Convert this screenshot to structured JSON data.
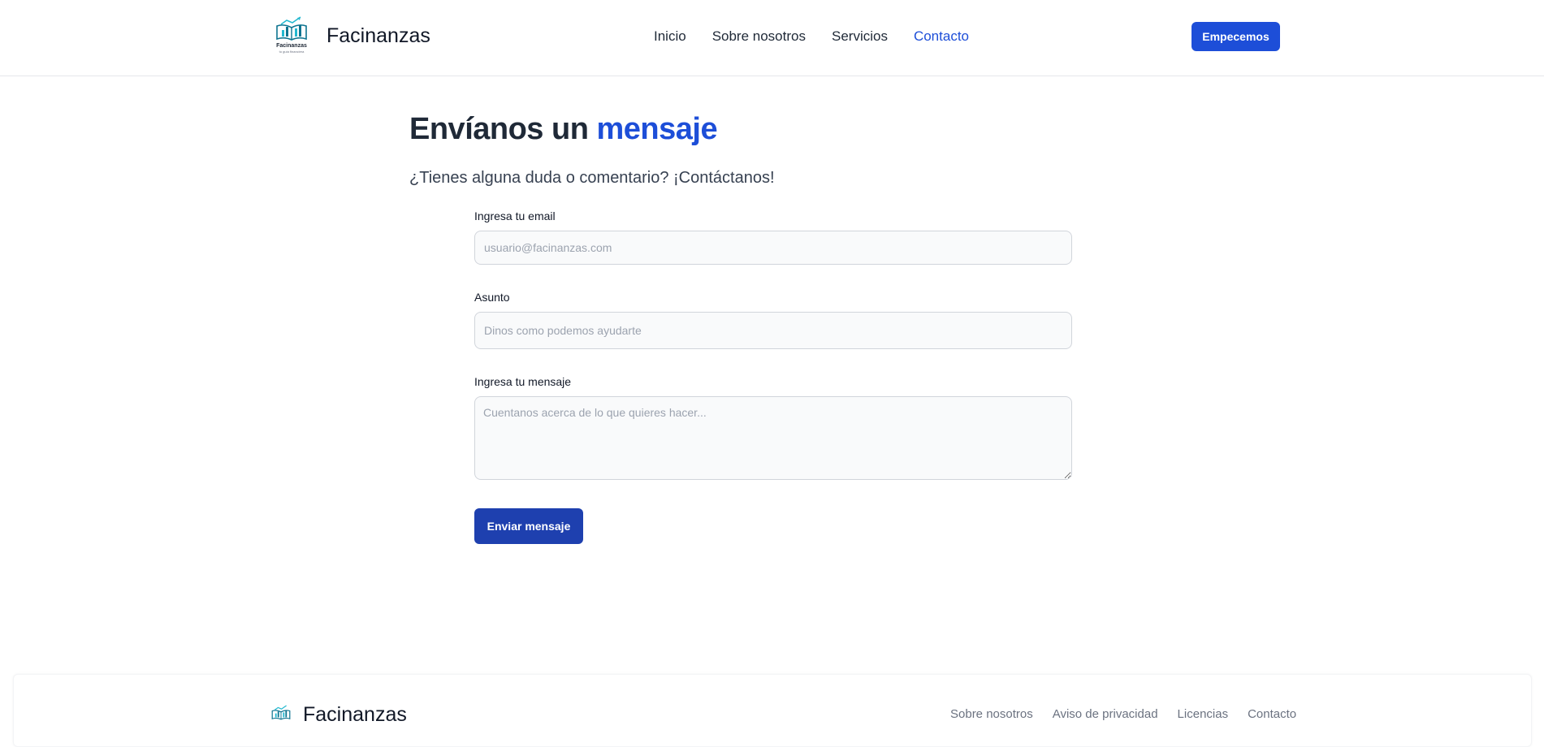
{
  "header": {
    "brand": "Facinanzas",
    "logo_text": "Facinanzas",
    "logo_subtext": "tu guía financiera",
    "nav": [
      {
        "label": "Inicio",
        "active": false
      },
      {
        "label": "Sobre nosotros",
        "active": false
      },
      {
        "label": "Servicios",
        "active": false
      },
      {
        "label": "Contacto",
        "active": true
      }
    ],
    "cta_label": "Empecemos"
  },
  "main": {
    "title_part1": "Envíanos un",
    "title_accent": "mensaje",
    "subtitle": "¿Tienes alguna duda o comentario? ¡Contáctanos!",
    "form": {
      "email_label": "Ingresa tu email",
      "email_placeholder": "usuario@facinanzas.com",
      "subject_label": "Asunto",
      "subject_placeholder": "Dinos como podemos ayudarte",
      "message_label": "Ingresa tu mensaje",
      "message_placeholder": "Cuentanos acerca de lo que quieres hacer...",
      "submit_label": "Enviar mensaje"
    }
  },
  "footer": {
    "brand": "Facinanzas",
    "links": [
      "Sobre nosotros",
      "Aviso de privacidad",
      "Licencias",
      "Contacto"
    ]
  },
  "colors": {
    "accent": "#1d4ed8",
    "submit": "#1e40af",
    "text": "#1f2937"
  },
  "icons": {
    "logo": "book-with-chart-logo"
  }
}
